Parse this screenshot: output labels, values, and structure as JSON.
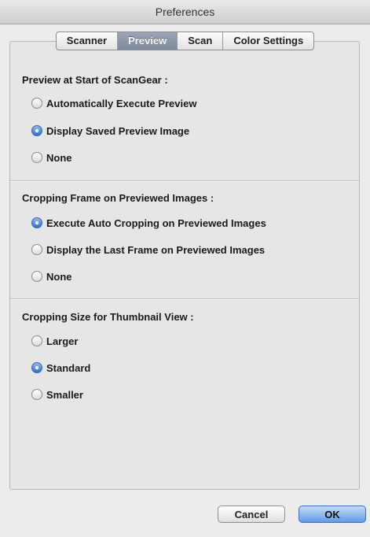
{
  "window": {
    "title": "Preferences"
  },
  "tabs": [
    {
      "label": "Scanner",
      "active": false
    },
    {
      "label": "Preview",
      "active": true
    },
    {
      "label": "Scan",
      "active": false
    },
    {
      "label": "Color Settings",
      "active": false
    }
  ],
  "sections": {
    "preview_start": {
      "title": "Preview at Start of ScanGear :",
      "options": [
        {
          "label": "Automatically Execute Preview",
          "checked": false
        },
        {
          "label": "Display Saved Preview Image",
          "checked": true
        },
        {
          "label": "None",
          "checked": false
        }
      ]
    },
    "cropping_frame": {
      "title": "Cropping Frame on Previewed Images :",
      "options": [
        {
          "label": "Execute Auto Cropping on Previewed Images",
          "checked": true
        },
        {
          "label": "Display the Last Frame on Previewed Images",
          "checked": false
        },
        {
          "label": "None",
          "checked": false
        }
      ]
    },
    "thumbnail_size": {
      "title": "Cropping Size for Thumbnail View :",
      "options": [
        {
          "label": "Larger",
          "checked": false
        },
        {
          "label": "Standard",
          "checked": true
        },
        {
          "label": "Smaller",
          "checked": false
        }
      ]
    }
  },
  "buttons": {
    "cancel": "Cancel",
    "ok": "OK"
  },
  "colors": {
    "accent": "#2d6cd6",
    "active_tab": "#8a96a5"
  }
}
